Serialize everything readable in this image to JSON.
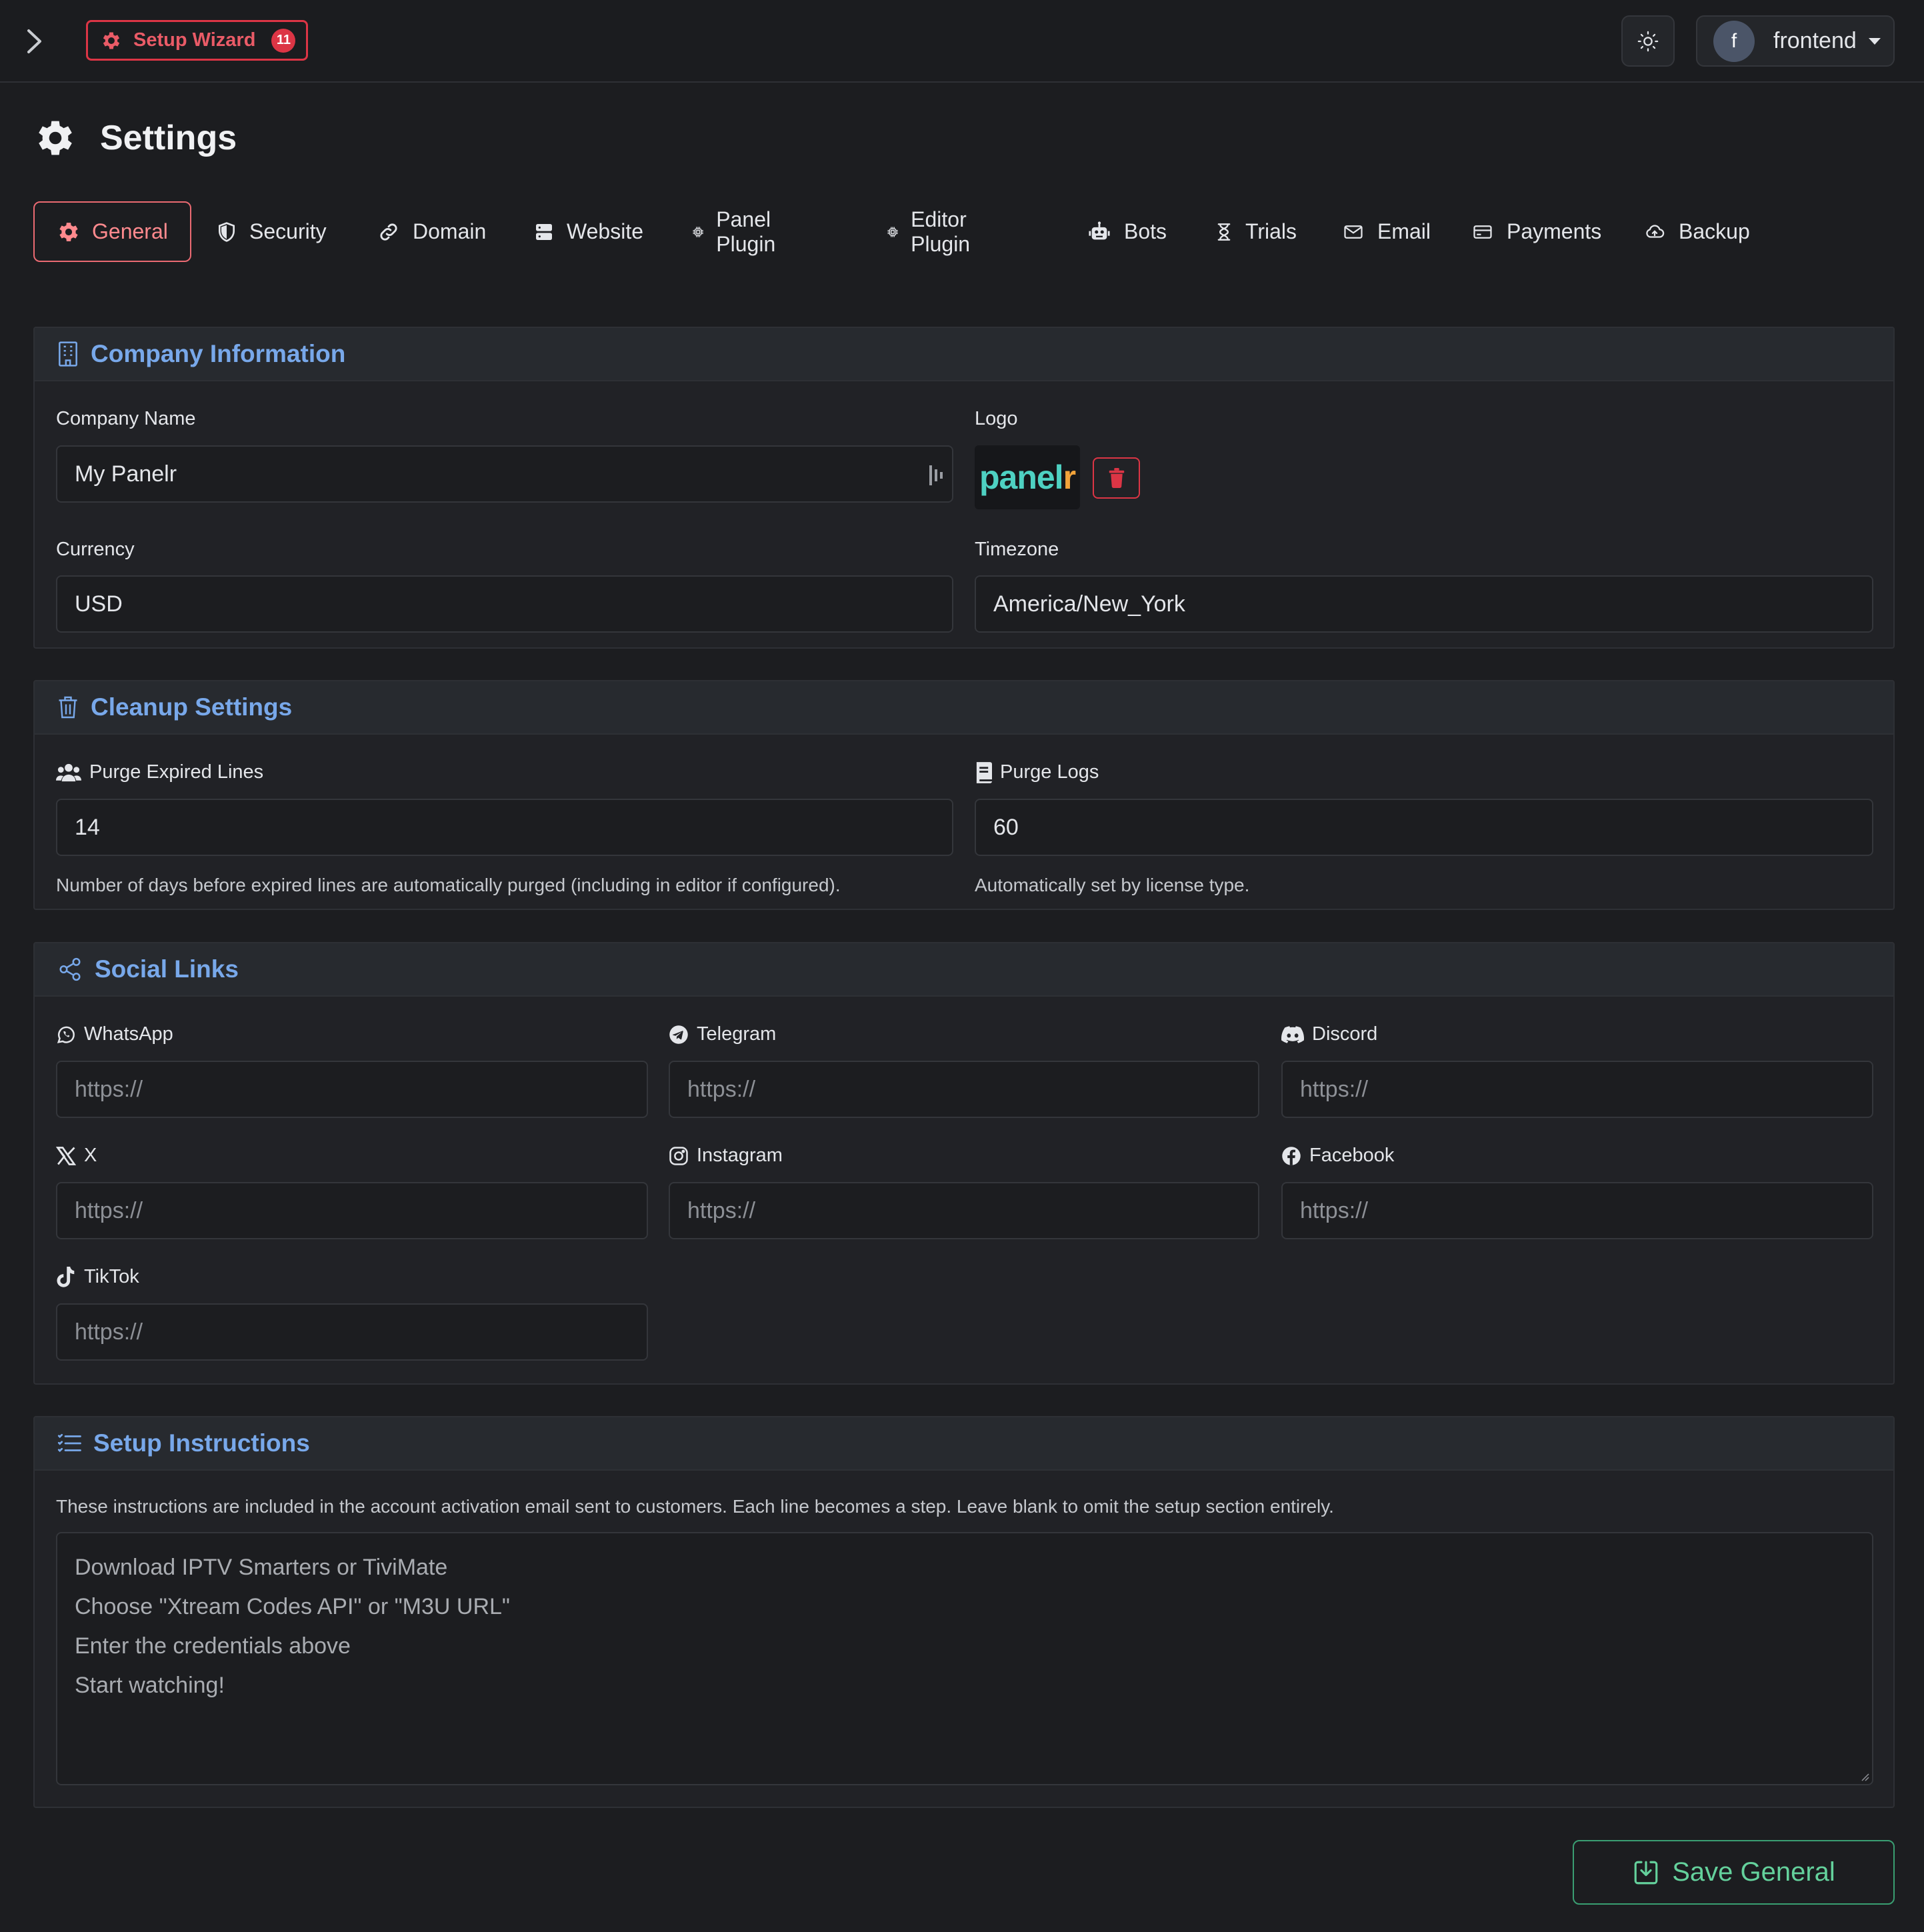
{
  "topbar": {
    "wizard_label": "Setup Wizard",
    "wizard_badge": "11",
    "user_initial": "f",
    "user_name": "frontend"
  },
  "page": {
    "title": "Settings"
  },
  "tabs": [
    {
      "label": "General",
      "icon": "gear-icon",
      "active": true
    },
    {
      "label": "Security",
      "icon": "shield-icon"
    },
    {
      "label": "Domain",
      "icon": "link-icon"
    },
    {
      "label": "Website",
      "icon": "server-icon"
    },
    {
      "label": "Panel Plugin",
      "icon": "cpu-icon"
    },
    {
      "label": "Editor Plugin",
      "icon": "cpu-icon"
    },
    {
      "label": "Bots",
      "icon": "robot-icon"
    },
    {
      "label": "Trials",
      "icon": "hourglass-icon"
    },
    {
      "label": "Email",
      "icon": "envelope-icon"
    },
    {
      "label": "Payments",
      "icon": "credit-card-icon"
    },
    {
      "label": "Backup",
      "icon": "cloud-upload-icon"
    }
  ],
  "company": {
    "title": "Company Information",
    "name_label": "Company Name",
    "name_value": "My Panelr",
    "logo_label": "Logo",
    "logo_text_a": "panel",
    "logo_text_b": "r",
    "currency_label": "Currency",
    "currency_value": "USD",
    "timezone_label": "Timezone",
    "timezone_value": "America/New_York"
  },
  "cleanup": {
    "title": "Cleanup Settings",
    "expired_label": "Purge Expired Lines",
    "expired_value": "14",
    "expired_help": "Number of days before expired lines are automatically purged (including in editor if configured).",
    "logs_label": "Purge Logs",
    "logs_value": "60",
    "logs_help": "Automatically set by license type."
  },
  "social": {
    "title": "Social Links",
    "placeholder": "https://",
    "links": [
      {
        "label": "WhatsApp",
        "icon": "whatsapp-icon"
      },
      {
        "label": "Telegram",
        "icon": "telegram-icon"
      },
      {
        "label": "Discord",
        "icon": "discord-icon"
      },
      {
        "label": "X",
        "icon": "x-icon"
      },
      {
        "label": "Instagram",
        "icon": "instagram-icon"
      },
      {
        "label": "Facebook",
        "icon": "facebook-icon"
      },
      {
        "label": "TikTok",
        "icon": "tiktok-icon"
      }
    ]
  },
  "instructions": {
    "title": "Setup Instructions",
    "help": "These instructions are included in the account activation email sent to customers. Each line becomes a step. Leave blank to omit the setup section entirely.",
    "lines": [
      "Download IPTV Smarters or TiviMate",
      "Choose \"Xtream Codes API\" or \"M3U URL\"",
      "Enter the credentials above",
      "Start watching!"
    ]
  },
  "save_label": "Save General",
  "colors": {
    "accent_blue": "#78a8ea",
    "danger": "#dc3545",
    "success": "#64d19c",
    "active_tab": "#ff8a8e"
  }
}
